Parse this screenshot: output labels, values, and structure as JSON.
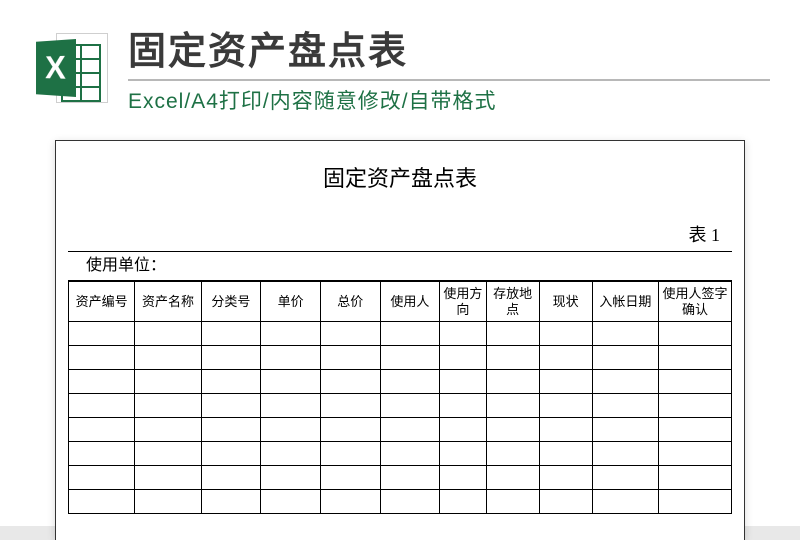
{
  "header": {
    "icon_letter": "X",
    "title": "固定资产盘点表",
    "subtitle": "Excel/A4打印/内容随意修改/自带格式"
  },
  "document": {
    "title": "固定资产盘点表",
    "sheet_label": "表 1",
    "unit_label": "使用单位：",
    "columns": [
      "资产编号",
      "资产名称",
      "分类号",
      "单价",
      "总价",
      "使用人",
      "使用方向",
      "存放地点",
      "现状",
      "入帐日期",
      "使用人签字确认"
    ],
    "row_count": 8
  }
}
